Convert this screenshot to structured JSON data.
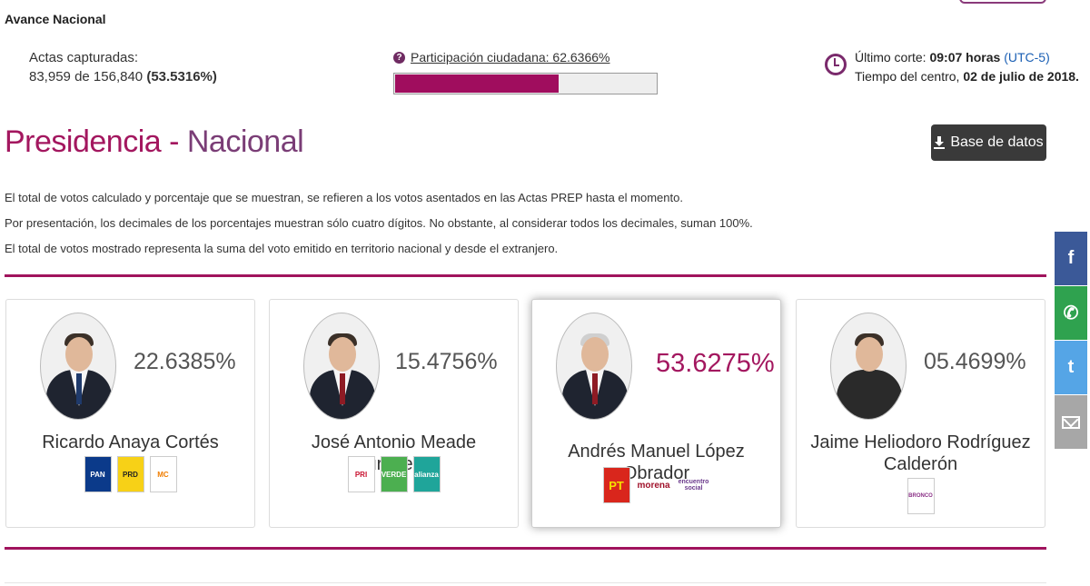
{
  "header": {
    "section_title": "Avance Nacional"
  },
  "actas": {
    "label": "Actas capturadas:",
    "captured": "83,959",
    "of_word": "de",
    "total": "156,840",
    "percent": "(53.5316%)"
  },
  "participacion": {
    "label": "Participación ciudadana: 62.6366%",
    "value_pct": 62.6366
  },
  "corte": {
    "line1_prefix": "Último corte:",
    "time": "09:07 horas",
    "tz": "(UTC-5)",
    "line2_prefix": "Tiempo del centro,",
    "date": "02 de julio de 2018."
  },
  "page": {
    "title_part1": "Presidencia -",
    "title_part2": "Nacional",
    "download_label": "Base de datos"
  },
  "notes": [
    "El total de votos calculado y porcentaje que se muestran, se refieren a los votos asentados en las Actas PREP hasta el momento.",
    "Por presentación, los decimales de los porcentajes muestran sólo cuatro dígitos. No obstante, al considerar todos los decimales, suman 100%.",
    "El total de votos mostrado representa la suma del voto emitido en territorio nacional y desde el extranjero."
  ],
  "candidates": [
    {
      "name": "Ricardo Anaya Cortés",
      "percent": "22.6385%",
      "parties": [
        "PAN",
        "PRD",
        "MC"
      ]
    },
    {
      "name": "José Antonio Meade Kuribreña",
      "percent": "15.4756%",
      "parties": [
        "PRI",
        "VERDE",
        "alianza"
      ]
    },
    {
      "name": "Andrés Manuel López Obrador",
      "percent": "53.6275%",
      "parties": [
        "PT",
        "morena",
        "encuentro social"
      ]
    },
    {
      "name": "Jaime Heliodoro Rodríguez Calderón",
      "percent": "05.4699%",
      "parties": [
        "BRONCO"
      ]
    }
  ],
  "social": {
    "facebook": "f",
    "whatsapp": "✆",
    "twitter": "t"
  },
  "colors": {
    "accent": "#a3175f",
    "bar_fill": "#a00d5e",
    "facebook": "#3b5998",
    "whatsapp": "#2fa24f",
    "twitter": "#55a5e6",
    "email": "#a7a7a7"
  }
}
